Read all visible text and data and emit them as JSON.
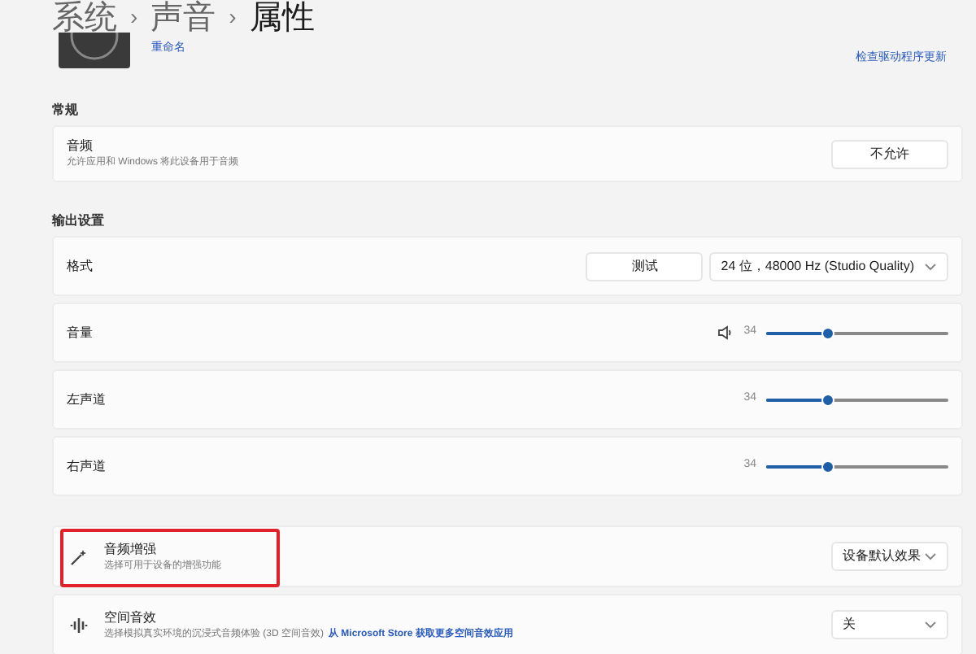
{
  "breadcrumb": [
    "系统",
    "声音",
    "属性"
  ],
  "breadcrumb_separator": "›",
  "device": {
    "rename_link": "重命名",
    "driver_link": "检查驱动程序更新"
  },
  "general": {
    "heading": "常规",
    "rows": [
      {
        "title": "音频",
        "subtitle": "允许应用和 Windows 将此设备用于音频",
        "button": "不允许"
      }
    ]
  },
  "output": {
    "heading": "输出设置",
    "rows": [
      {
        "kind": "format",
        "title": "格式",
        "button": "测试",
        "dropdown": "24 位，48000 Hz (Studio Quality)"
      },
      {
        "kind": "slider",
        "title": "音量",
        "speaker_icon": true,
        "reading": "34",
        "level": 0.34
      },
      {
        "kind": "slider",
        "title": "左声道",
        "speaker_icon": false,
        "reading": "34",
        "level": 0.34
      },
      {
        "kind": "slider",
        "title": "右声道",
        "speaker_icon": false,
        "reading": "34",
        "level": 0.34
      }
    ]
  },
  "effects": [
    {
      "kind": "enhancement",
      "title": "音频增强",
      "subtitle": "选择可用于设备的增强功能",
      "highlighted": true,
      "dropdown": "设备默认效果"
    },
    {
      "kind": "spatial",
      "title": "空间音效",
      "subtitle": "选择模拟真实环境的沉浸式音频体验 (3D 空间音效)",
      "link": "从 Microsoft Store 获取更多空间音效应用",
      "highlighted": false,
      "dropdown": "关"
    }
  ]
}
